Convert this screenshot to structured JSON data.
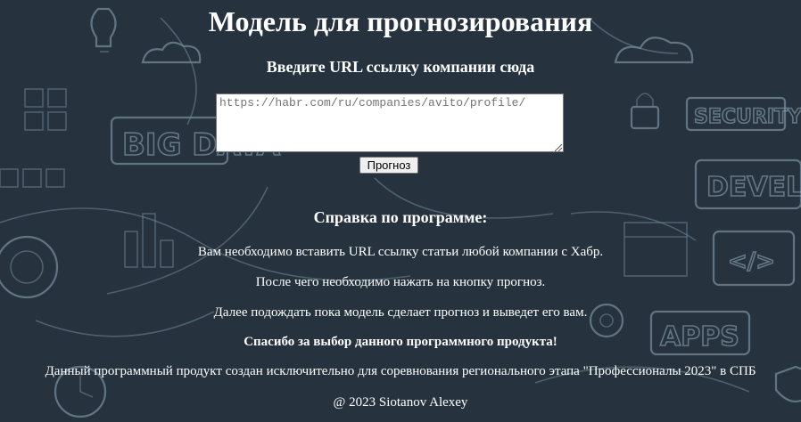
{
  "page": {
    "title": "Модель для прогнозирования",
    "subtitle": "Введите URL ссылку компании сюда"
  },
  "form": {
    "url_placeholder": "https://habr.com/ru/companies/avito/profile/",
    "submit_label": "Прогноз"
  },
  "help": {
    "title": "Справка по программе:",
    "lines": [
      "Вам необходимо вставить URL ссылку статьи любой компании с Хабр.",
      "После чего необходимо нажать на кнопку прогноз.",
      "Далее подождать пока модель сделает прогноз и выведет его вам.",
      "Спасибо за выбор данного программного продукта!",
      "Данный программный продукт создан исключительно для соревнования регионального этапа \"Профессионалы 2023\" в СПБ",
      "@ 2023 Siotanov Alexey"
    ]
  },
  "background": {
    "words": [
      "BIG DATA",
      "SECURITY",
      "DEVELOP",
      "APPS"
    ],
    "icons": [
      "lightbulb-icon",
      "cloud-icon",
      "gear-icon",
      "lock-icon",
      "code-icon",
      "chart-icon",
      "grid-icon",
      "clock-icon",
      "shield-icon"
    ],
    "colors": {
      "base": "#26333f",
      "sketch": "#8aa0b0"
    }
  }
}
